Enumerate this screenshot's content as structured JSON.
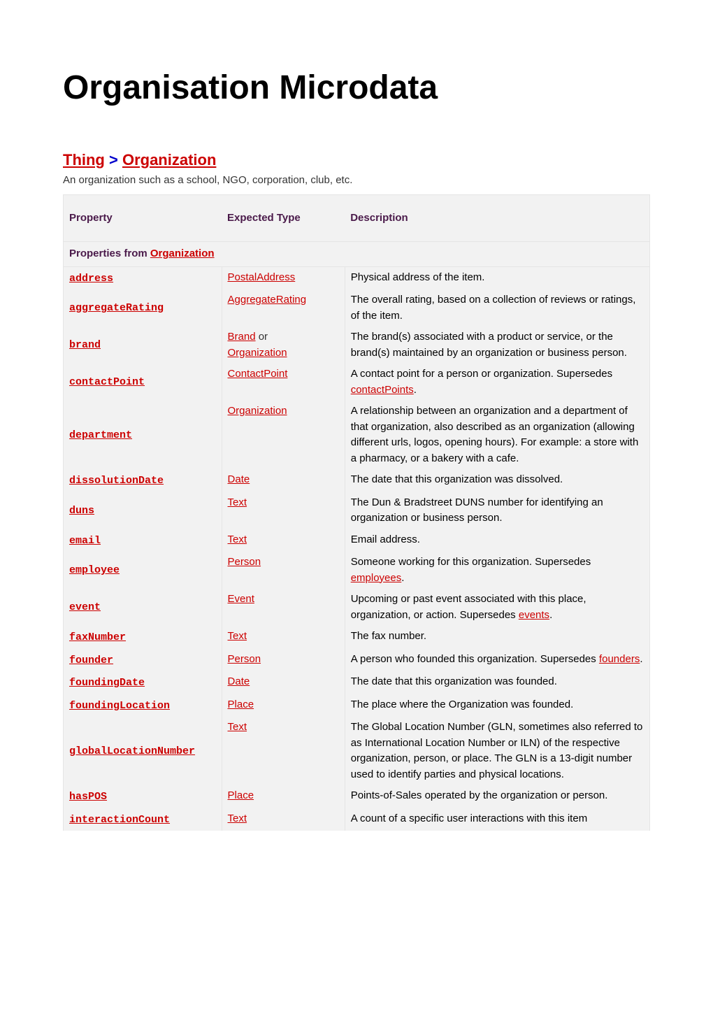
{
  "title": "Organisation Microdata",
  "breadcrumb": {
    "thing": "Thing",
    "sep": " > ",
    "organization": "Organization"
  },
  "subtitle": "An organization such as a school, NGO, corporation, club, etc.",
  "headers": {
    "property": "Property",
    "expected_type": "Expected Type",
    "description": "Description"
  },
  "section": {
    "prefix": "Properties from ",
    "link": "Organization"
  },
  "rows": [
    {
      "prop": "address",
      "types": [
        {
          "t": "PostalAddress"
        }
      ],
      "desc": [
        {
          "text": "Physical address of the item."
        }
      ]
    },
    {
      "prop": "aggregateRating",
      "types": [
        {
          "t": "AggregateRating"
        }
      ],
      "desc": [
        {
          "text": "The overall rating, based on a collection of reviews or ratings, of the item."
        }
      ]
    },
    {
      "prop": "brand",
      "types": [
        {
          "t": "Brand"
        },
        {
          "or": "  or "
        },
        {
          "t": "Organization"
        }
      ],
      "desc": [
        {
          "text": "The brand(s) associated with a product or service, or the brand(s) maintained by an organization or business person."
        }
      ]
    },
    {
      "prop": "contactPoint",
      "types": [
        {
          "t": "ContactPoint"
        }
      ],
      "desc": [
        {
          "text": "A contact point for a person or organization. Supersedes "
        },
        {
          "link": "contactPoints"
        },
        {
          "text": "."
        }
      ]
    },
    {
      "prop": "department",
      "types": [
        {
          "t": "Organization"
        }
      ],
      "desc": [
        {
          "text": "A relationship between an organization and a department of that organization, also described as an organization (allowing different urls, logos, opening hours). For example: a store with a pharmacy, or a bakery with a cafe."
        }
      ]
    },
    {
      "prop": "dissolutionDate",
      "types": [
        {
          "t": "Date"
        }
      ],
      "desc": [
        {
          "text": "The date that this organization was dissolved."
        }
      ]
    },
    {
      "prop": "duns",
      "types": [
        {
          "t": "Text"
        }
      ],
      "desc": [
        {
          "text": "The Dun & Bradstreet DUNS number for identifying an organization or business person."
        }
      ]
    },
    {
      "prop": "email",
      "types": [
        {
          "t": "Text"
        }
      ],
      "desc": [
        {
          "text": "Email address."
        }
      ]
    },
    {
      "prop": "employee",
      "types": [
        {
          "t": "Person"
        }
      ],
      "desc": [
        {
          "text": "Someone working for this organization. Supersedes "
        },
        {
          "link": "employees"
        },
        {
          "text": "."
        }
      ]
    },
    {
      "prop": "event",
      "types": [
        {
          "t": "Event"
        }
      ],
      "desc": [
        {
          "text": "Upcoming or past event associated with this place, organization, or action. Supersedes "
        },
        {
          "link": "events"
        },
        {
          "text": "."
        }
      ]
    },
    {
      "prop": "faxNumber",
      "types": [
        {
          "t": "Text"
        }
      ],
      "desc": [
        {
          "text": "The fax number."
        }
      ]
    },
    {
      "prop": "founder",
      "types": [
        {
          "t": "Person"
        }
      ],
      "desc": [
        {
          "text": "A person who founded this organization. Supersedes "
        },
        {
          "link": "founders"
        },
        {
          "text": "."
        }
      ]
    },
    {
      "prop": "foundingDate",
      "types": [
        {
          "t": "Date"
        }
      ],
      "desc": [
        {
          "text": "The date that this organization was founded."
        }
      ]
    },
    {
      "prop": "foundingLocation",
      "types": [
        {
          "t": "Place"
        }
      ],
      "desc": [
        {
          "text": "The place where the Organization was founded."
        }
      ]
    },
    {
      "prop": "globalLocationNumber",
      "types": [
        {
          "t": "Text"
        }
      ],
      "desc": [
        {
          "text": "The Global Location Number (GLN, sometimes also referred to as International Location Number or ILN) of the respective organization, person, or place. The GLN is a 13-digit number used to identify parties and physical locations."
        }
      ]
    },
    {
      "prop": "hasPOS",
      "types": [
        {
          "t": "Place"
        }
      ],
      "desc": [
        {
          "text": "Points-of-Sales operated by the organization or person."
        }
      ]
    },
    {
      "prop": "interactionCount",
      "types": [
        {
          "t": "Text"
        }
      ],
      "desc": [
        {
          "text": "A count of a specific user interactions with this item"
        }
      ]
    }
  ]
}
